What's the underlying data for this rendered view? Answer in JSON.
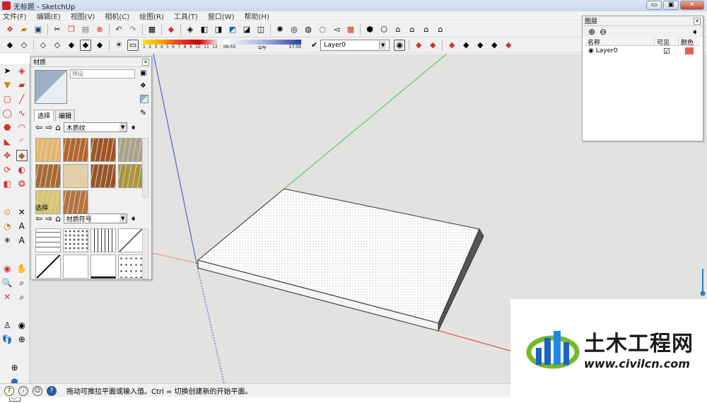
{
  "window": {
    "title": "无标题 - SketchUp",
    "min": "▭",
    "max": "▣",
    "close": "✕"
  },
  "menu": [
    "文件(F)",
    "编辑(E)",
    "视图(V)",
    "相机(C)",
    "绘图(R)",
    "工具(T)",
    "窗口(W)",
    "帮助(H)"
  ],
  "shadow": {
    "months": [
      "1",
      "2",
      "3",
      "4",
      "5",
      "6",
      "7",
      "8",
      "9",
      "10",
      "11",
      "12"
    ],
    "time_start": "06:55",
    "time_mid": "中午",
    "time_end": "17:00"
  },
  "layer_toolbar": {
    "current": "Layer0",
    "check": "✔"
  },
  "materials": {
    "title": "材质",
    "preset_placeholder": "预设",
    "tabs": [
      "选择",
      "编辑"
    ],
    "library": "木质纹",
    "secondary_label": "选择",
    "secondary_library": "材质符号",
    "wood_colors": [
      "#e6b768",
      "#b4652b",
      "#a25422",
      "#aaa286",
      "#a86930",
      "#e5cfa2",
      "#9a5327",
      "#a8963c",
      "#d8c46c",
      "#b6733c"
    ]
  },
  "layers": {
    "title": "图层",
    "columns": [
      "名称",
      "可见",
      "颜色"
    ],
    "rows": [
      {
        "name": "Layer0",
        "visible": "☑",
        "color": "#e35d5d"
      }
    ]
  },
  "status": {
    "text": "拖动可推拉平面或输入值。Ctrl = 切换创建新的开始平面。"
  },
  "logo": {
    "name": "土木工程网",
    "url": "www.civilcn.com"
  }
}
